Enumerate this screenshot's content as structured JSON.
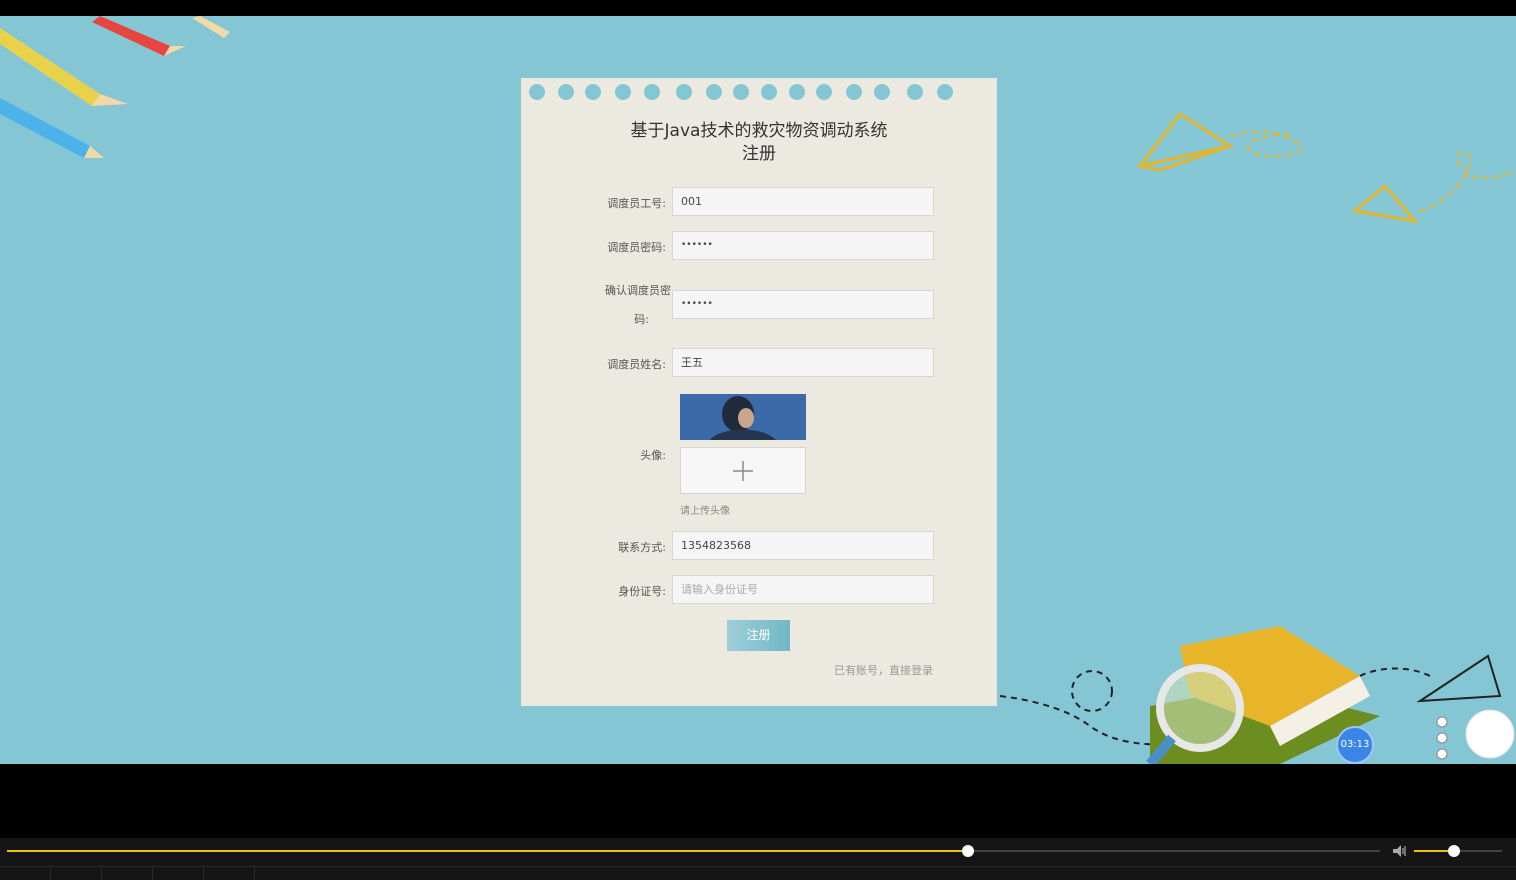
{
  "form": {
    "title_line1": "基于Java技术的救灾物资调动系统",
    "title_line2": "注册",
    "fields": [
      {
        "label": "调度员工号:",
        "value": "001",
        "placeholder": ""
      },
      {
        "label": "调度员密码:",
        "value": "••••••",
        "placeholder": ""
      },
      {
        "label_line1": "确认调度员密",
        "label_line2": "码:",
        "value": "••••••",
        "placeholder": ""
      },
      {
        "label": "调度员姓名:",
        "value": "王五",
        "placeholder": ""
      },
      {
        "label": "联系方式:",
        "value": "1354823568",
        "placeholder": ""
      },
      {
        "label": "身份证号:",
        "value": "",
        "placeholder": "请输入身份证号"
      }
    ],
    "avatar_label": "头像:",
    "upload_hint": "请上传头像",
    "upload_symbol": "+",
    "submit_label": "注册",
    "login_link": "已有账号，直接登录"
  },
  "player": {
    "timer": "03:13",
    "progress": 0.7,
    "volume": 0.45
  },
  "colors": {
    "background": "#85c6d5",
    "card": "#ebe9e0",
    "accent": "#f0c010"
  }
}
